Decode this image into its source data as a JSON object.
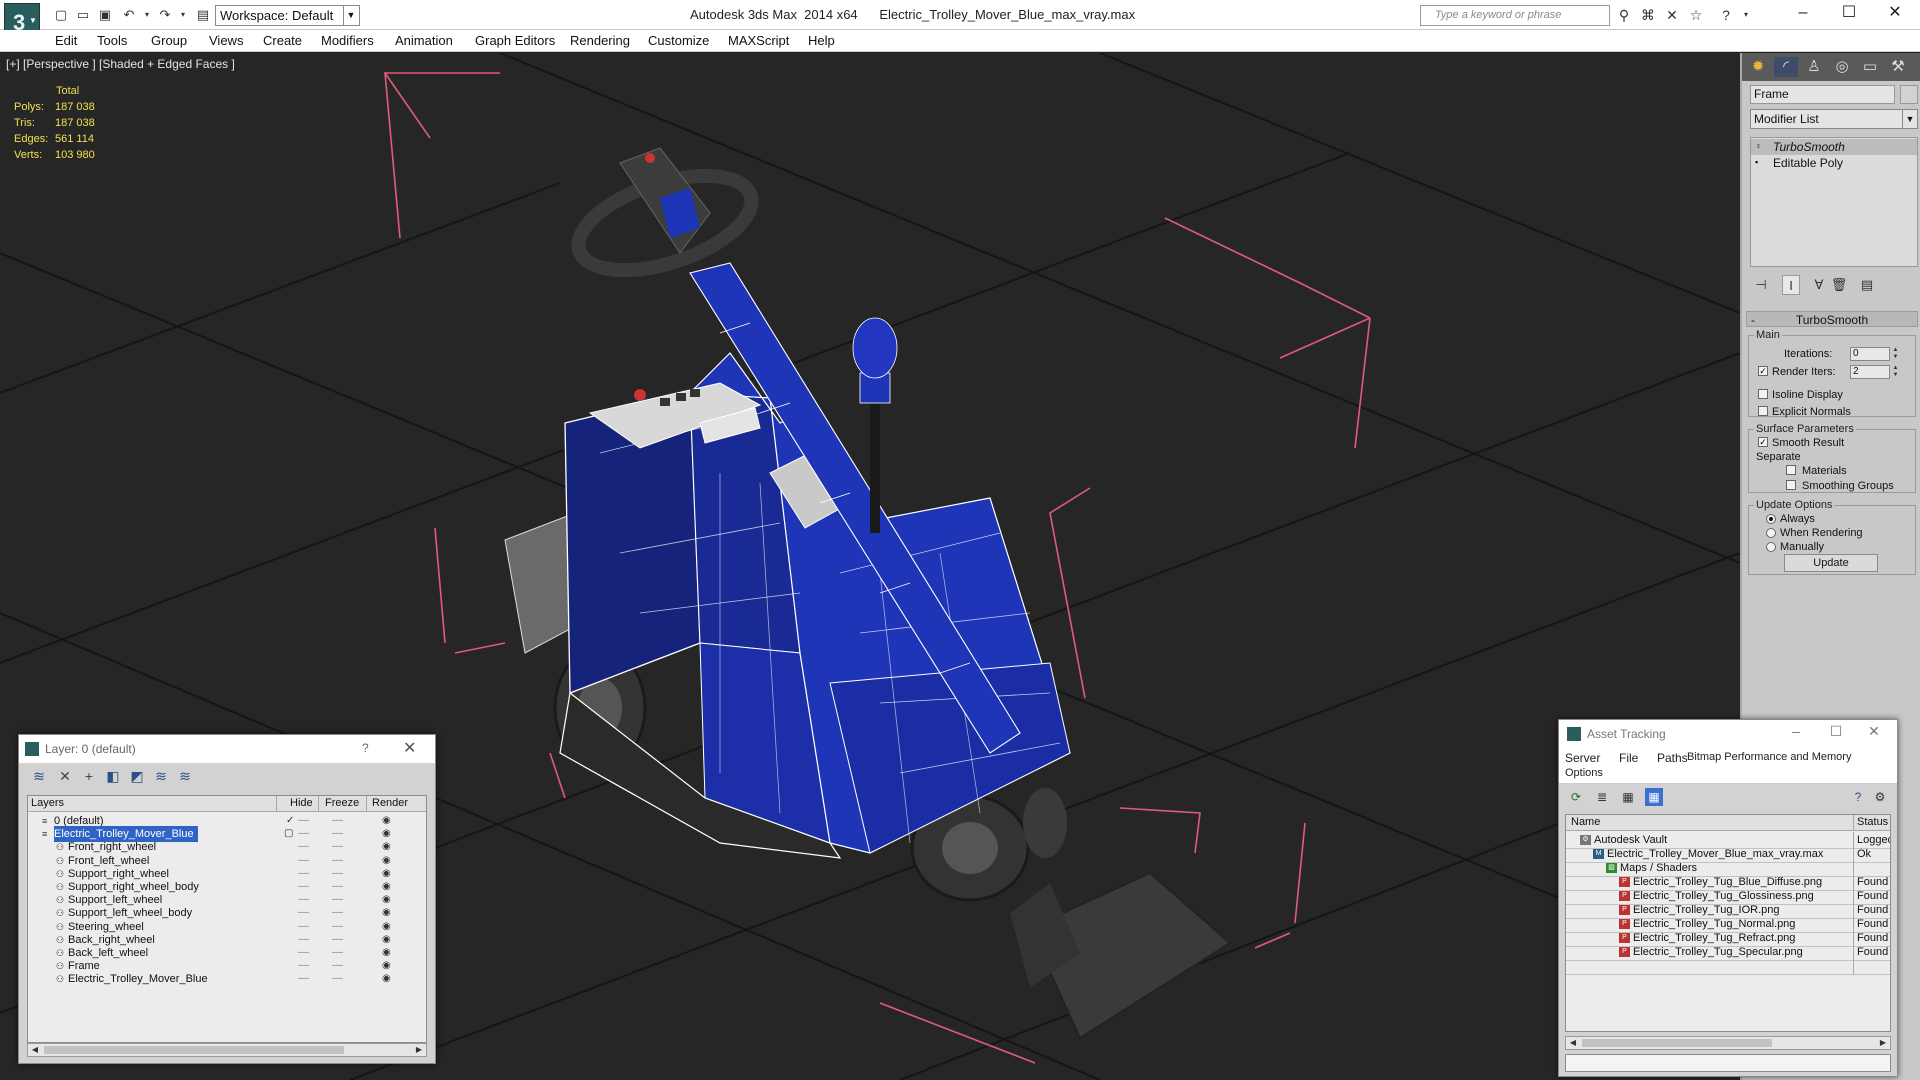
{
  "titlebar": {
    "workspace": "Workspace: Default",
    "app_name": "Autodesk 3ds Max  2014 x64",
    "file_name": "Electric_Trolley_Mover_Blue_max_vray.max",
    "search_placeholder": "Type a keyword or phrase"
  },
  "menu": [
    "Edit",
    "Tools",
    "Group",
    "Views",
    "Create",
    "Modifiers",
    "Animation",
    "Graph Editors",
    "Rendering",
    "Customize",
    "MAXScript",
    "Help"
  ],
  "viewport": {
    "label": "[+] [Perspective ] [Shaded + Edged Faces ]",
    "stats": {
      "total_label": "Total",
      "rows": [
        {
          "label": "Polys:",
          "value": "187 038"
        },
        {
          "label": "Tris:",
          "value": "187 038"
        },
        {
          "label": "Edges:",
          "value": "561 114"
        },
        {
          "label": "Verts:",
          "value": "103 980"
        }
      ]
    }
  },
  "command_panel": {
    "object_name": "Frame",
    "modifier_list": "Modifier List",
    "stack": [
      {
        "label": "TurboSmooth",
        "selected": true
      },
      {
        "label": "Editable Poly",
        "selected": false
      }
    ],
    "turbosmooth": {
      "title": "TurboSmooth",
      "main": "Main",
      "iterations_label": "Iterations:",
      "iterations": "0",
      "render_iters_label": "Render Iters:",
      "render_iters": "2",
      "isoline_display": "Isoline Display",
      "explicit_normals": "Explicit Normals",
      "surface_parameters": "Surface Parameters",
      "smooth_result": "Smooth Result",
      "separate": "Separate",
      "materials": "Materials",
      "smoothing_groups": "Smoothing Groups",
      "update_options": "Update Options",
      "always": "Always",
      "when_rendering": "When Rendering",
      "manually": "Manually",
      "update_button": "Update"
    }
  },
  "layer_dialog": {
    "title": "Layer: 0 (default)",
    "help": "?",
    "columns": {
      "layers": "Layers",
      "hide": "Hide",
      "freeze": "Freeze",
      "render": "Render"
    },
    "rows": [
      {
        "name": "0 (default)",
        "level": 0,
        "selected": false
      },
      {
        "name": "Electric_Trolley_Mover_Blue",
        "level": 0,
        "selected": true
      },
      {
        "name": "Front_right_wheel",
        "level": 1,
        "selected": false
      },
      {
        "name": "Front_left_wheel",
        "level": 1,
        "selected": false
      },
      {
        "name": "Support_right_wheel",
        "level": 1,
        "selected": false
      },
      {
        "name": "Support_right_wheel_body",
        "level": 1,
        "selected": false
      },
      {
        "name": "Support_left_wheel",
        "level": 1,
        "selected": false
      },
      {
        "name": "Support_left_wheel_body",
        "level": 1,
        "selected": false
      },
      {
        "name": "Steering_wheel",
        "level": 1,
        "selected": false
      },
      {
        "name": "Back_right_wheel",
        "level": 1,
        "selected": false
      },
      {
        "name": "Back_left_wheel",
        "level": 1,
        "selected": false
      },
      {
        "name": "Frame",
        "level": 1,
        "selected": false
      },
      {
        "name": "Electric_Trolley_Mover_Blue",
        "level": 1,
        "selected": false
      }
    ]
  },
  "asset_dialog": {
    "title": "Asset Tracking",
    "menu": [
      "Server",
      "File",
      "Paths",
      "Bitmap Performance and Memory",
      "Options"
    ],
    "columns": {
      "name": "Name",
      "status": "Status"
    },
    "rows": [
      {
        "name": "Autodesk Vault",
        "status": "Logged",
        "level": 0,
        "icon": "vault-icon"
      },
      {
        "name": "Electric_Trolley_Mover_Blue_max_vray.max",
        "status": "Ok",
        "level": 1,
        "icon": "max-file-icon"
      },
      {
        "name": "Maps / Shaders",
        "status": "",
        "level": 2,
        "icon": "maps-icon"
      },
      {
        "name": "Electric_Trolley_Tug_Blue_Diffuse.png",
        "status": "Found",
        "level": 3,
        "icon": "png-file-icon"
      },
      {
        "name": "Electric_Trolley_Tug_Glossiness.png",
        "status": "Found",
        "level": 3,
        "icon": "png-file-icon"
      },
      {
        "name": "Electric_Trolley_Tug_IOR.png",
        "status": "Found",
        "level": 3,
        "icon": "png-file-icon"
      },
      {
        "name": "Electric_Trolley_Tug_Normal.png",
        "status": "Found",
        "level": 3,
        "icon": "png-file-icon"
      },
      {
        "name": "Electric_Trolley_Tug_Refract.png",
        "status": "Found",
        "level": 3,
        "icon": "png-file-icon"
      },
      {
        "name": "Electric_Trolley_Tug_Specular.png",
        "status": "Found",
        "level": 3,
        "icon": "png-file-icon"
      }
    ]
  },
  "colors": {
    "viewport_bg": "#262626",
    "stats_text": "#f2e04e",
    "body_blue": "#1c2fa8",
    "wire": "#ffffff",
    "bbox": "#e25a78",
    "selection": "#2f63c4"
  }
}
